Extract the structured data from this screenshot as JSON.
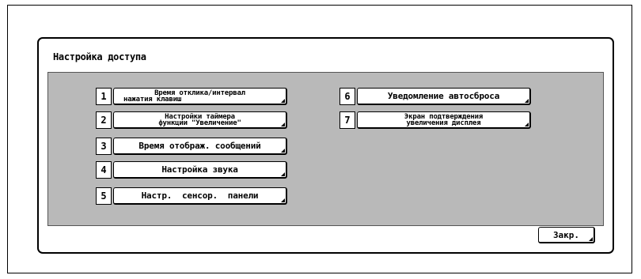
{
  "dialog": {
    "title": "Настройка доступа",
    "close_label": "Закр."
  },
  "items": [
    {
      "num": "1",
      "lines": [
        "Время отклика/интервал",
        "нажатия клавиш"
      ]
    },
    {
      "num": "2",
      "lines": [
        "Настройки таймера",
        "функции \"Увеличение\""
      ]
    },
    {
      "num": "3",
      "lines": [
        "Время отображ. сообщений"
      ]
    },
    {
      "num": "4",
      "lines": [
        "Настройка звука"
      ]
    },
    {
      "num": "5",
      "lines": [
        "Настр.  сенсор.  панели"
      ]
    },
    {
      "num": "6",
      "lines": [
        "Уведомление автосброса"
      ]
    },
    {
      "num": "7",
      "lines": [
        "Экран подтверждения",
        "увеличения дисплея"
      ]
    }
  ]
}
